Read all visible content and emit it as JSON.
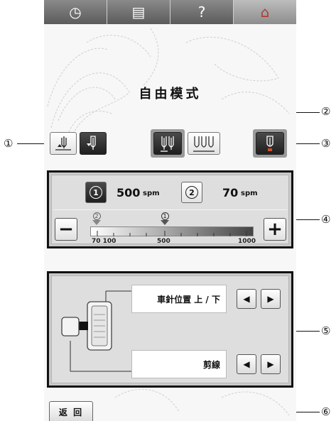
{
  "topbar": {
    "tabs": [
      {
        "icon": "clock-icon",
        "glyph": "◷"
      },
      {
        "icon": "document-icon",
        "glyph": "▤"
      },
      {
        "icon": "help-icon",
        "glyph": "?"
      },
      {
        "icon": "home-icon",
        "glyph": "⌂"
      }
    ]
  },
  "screen": {
    "title": "自由模式"
  },
  "speed": {
    "preset1": {
      "badge": "1",
      "value": "500",
      "unit": "spm"
    },
    "preset2": {
      "badge": "2",
      "value": "70",
      "unit": "spm"
    },
    "minus_glyph": "−",
    "plus_glyph": "+",
    "marker1_label": "1",
    "marker2_label": "2",
    "ticks": [
      "70 100",
      "500",
      "1000"
    ],
    "marker1_fraction": 0.46,
    "marker2_fraction": 0.0
  },
  "pedal": {
    "row1_label": "車針位置 上 / 下",
    "row2_label": "剪線",
    "left_glyph": "◀",
    "right_glyph": "▶"
  },
  "footer": {
    "back_label": "返 回"
  },
  "callouts": [
    "①",
    "②",
    "③",
    "④",
    "⑤",
    "⑥"
  ],
  "colors": {
    "panel_border": "#111111",
    "dark_button": "#2a2a2a",
    "topbar": "#6e6e6e"
  }
}
